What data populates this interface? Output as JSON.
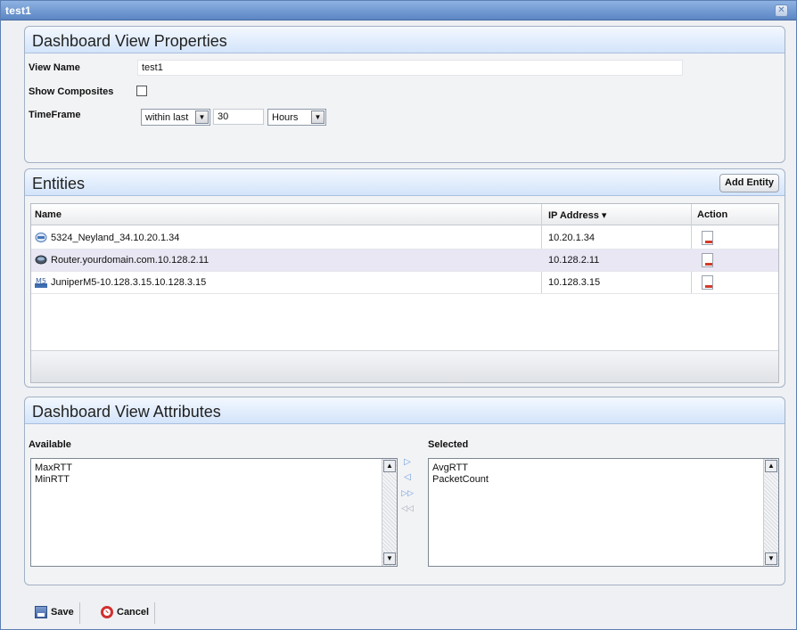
{
  "window": {
    "title": "test1",
    "close_symbol": "✕"
  },
  "properties": {
    "title": "Dashboard View Properties",
    "view_name_label": "View Name",
    "view_name_value": "test1",
    "show_composites_label": "Show Composites",
    "show_composites_checked": false,
    "timeframe_label": "TimeFrame",
    "timeframe_mode": "within last",
    "timeframe_value": "30",
    "timeframe_unit": "Hours"
  },
  "entities": {
    "title": "Entities",
    "add_button": "Add Entity",
    "columns": {
      "name": "Name",
      "ip": "IP Address ▾",
      "action": "Action"
    },
    "rows": [
      {
        "name": "5324_Neyland_34.10.20.1.34",
        "ip": "10.20.1.34",
        "icon": "switch-device-icon"
      },
      {
        "name": "Router.yourdomain.com.10.128.2.11",
        "ip": "10.128.2.11",
        "icon": "router-device-icon"
      },
      {
        "name": "JuniperM5-10.128.3.15.10.128.3.15",
        "ip": "10.128.3.15",
        "icon": "juniper-device-icon"
      }
    ]
  },
  "attributes": {
    "title": "Dashboard View Attributes",
    "available_label": "Available",
    "selected_label": "Selected",
    "available": [
      "MaxRTT",
      "MinRTT"
    ],
    "selected": [
      "AvgRTT",
      "PacketCount"
    ]
  },
  "footer": {
    "save_label": "Save",
    "cancel_label": "Cancel"
  },
  "colors": {
    "accent": "#5b86c4",
    "header_blue": "#d3e4fa",
    "alt_row": "#e8e7f3"
  }
}
